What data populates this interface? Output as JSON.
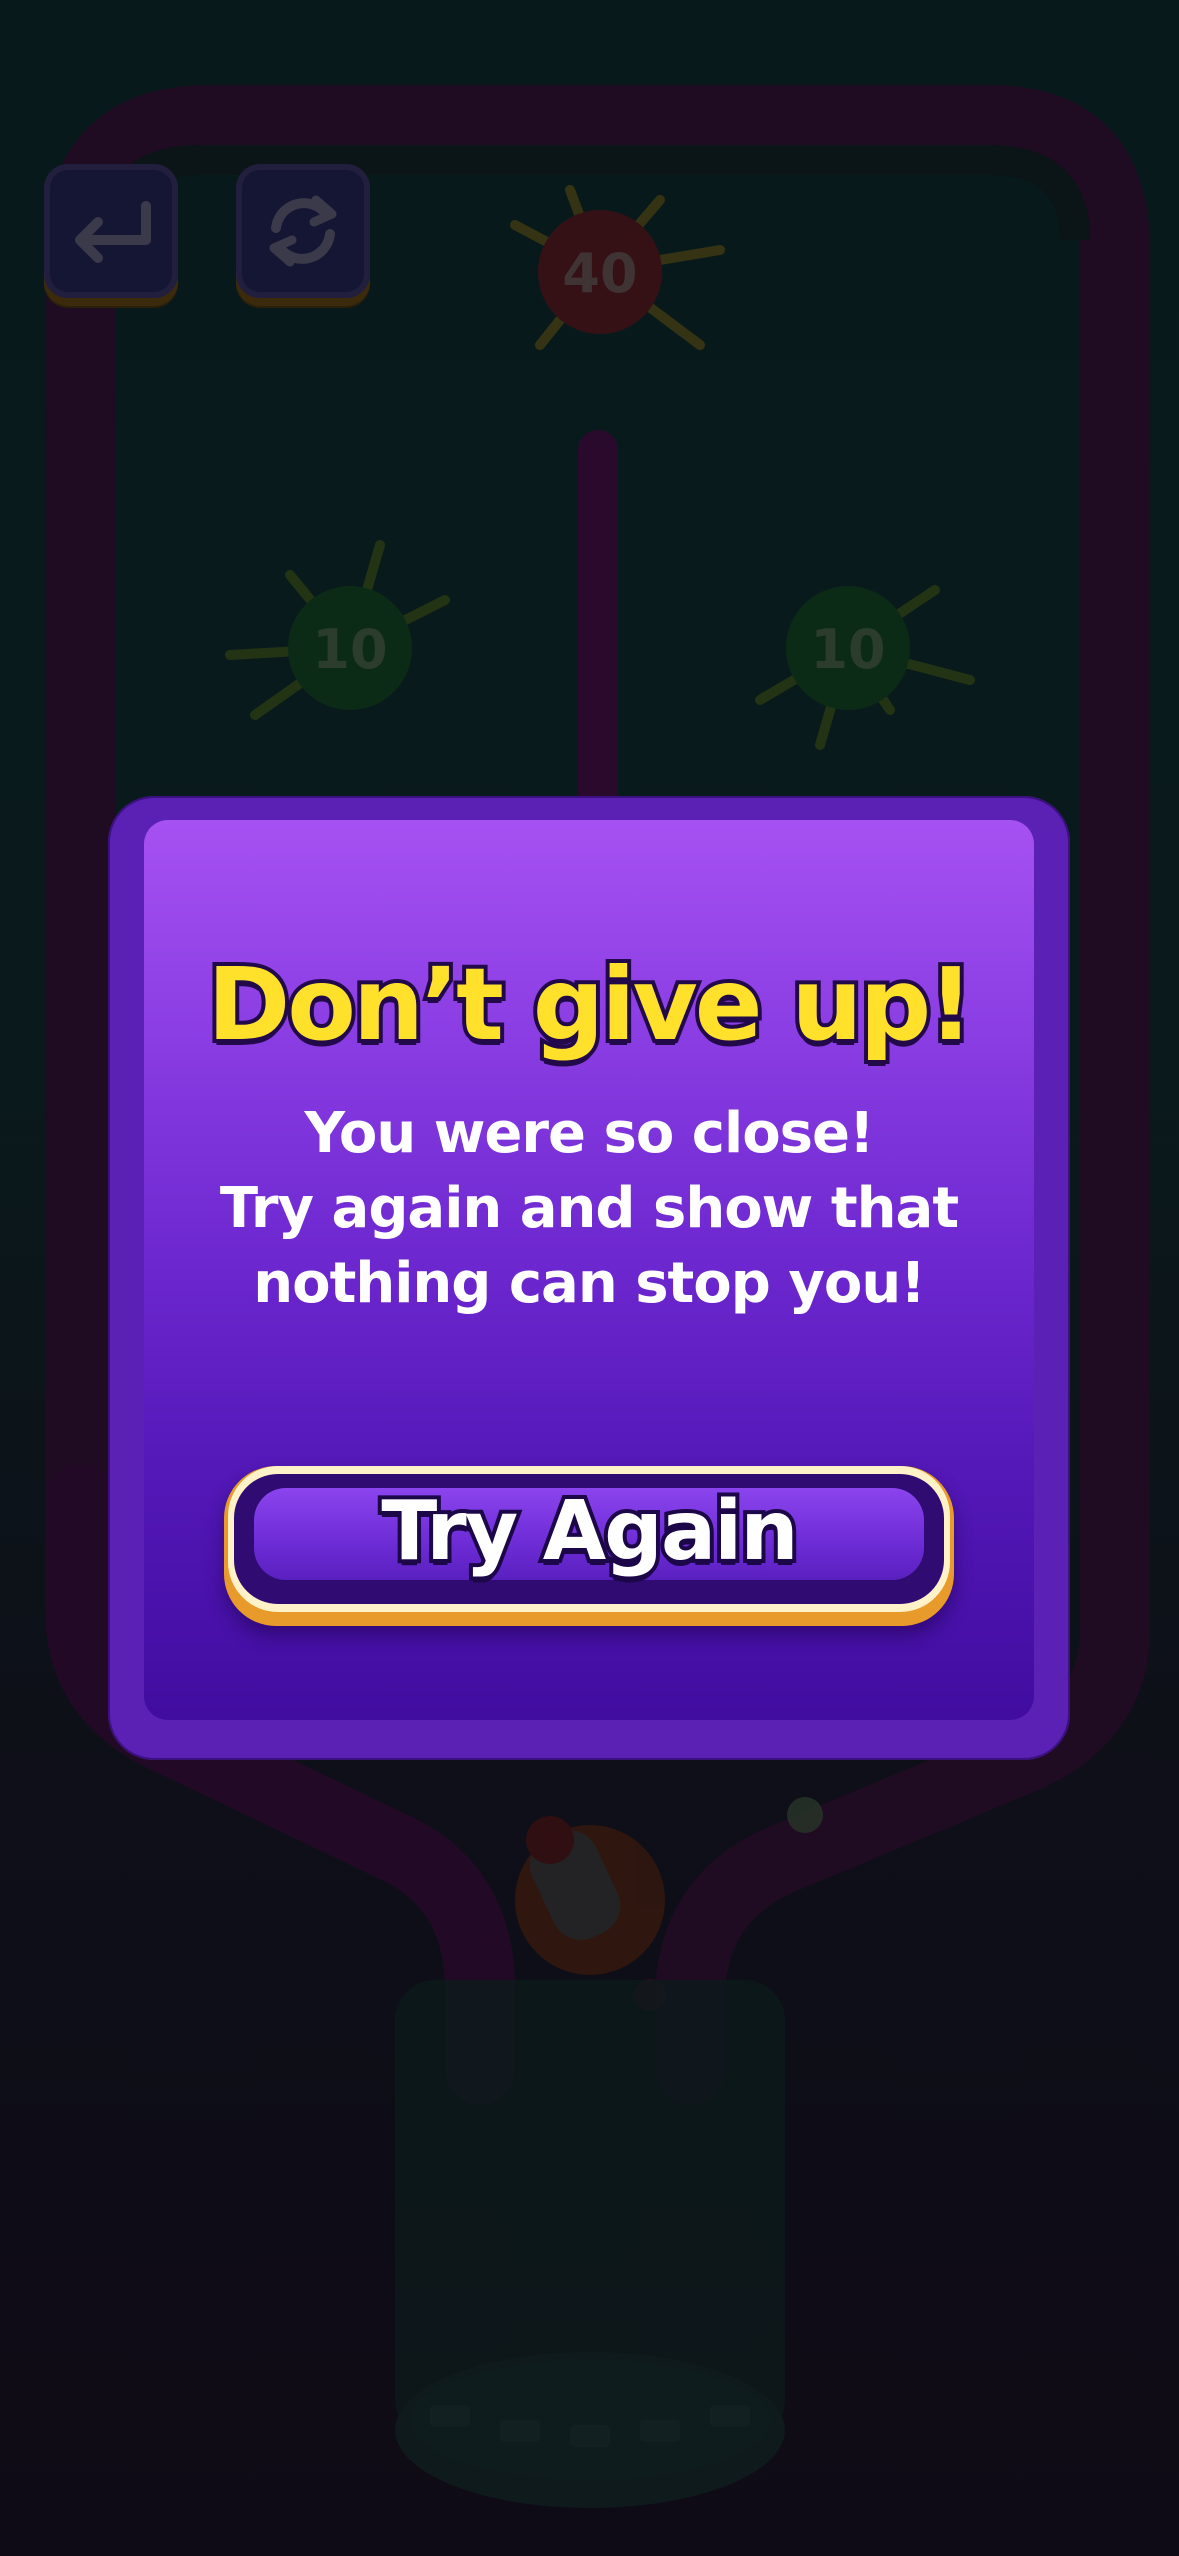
{
  "hud": {
    "back_icon": "undo-arrow-icon",
    "restart_icon": "restart-icon"
  },
  "targets": [
    {
      "value": "40",
      "color": "#5a0c12"
    },
    {
      "value": "10",
      "color": "#0f3a12"
    },
    {
      "value": "10",
      "color": "#0f3a12"
    }
  ],
  "dialog": {
    "title": "Don’t give up!",
    "message_lines": [
      "You were so close!",
      "Try again and show that",
      "nothing can stop you!"
    ],
    "button_label": "Try Again"
  },
  "colors": {
    "title": "#ffe02a",
    "panel": "#5a21b4",
    "button_rim": "#e89a2a",
    "track": "#2a0a28"
  }
}
